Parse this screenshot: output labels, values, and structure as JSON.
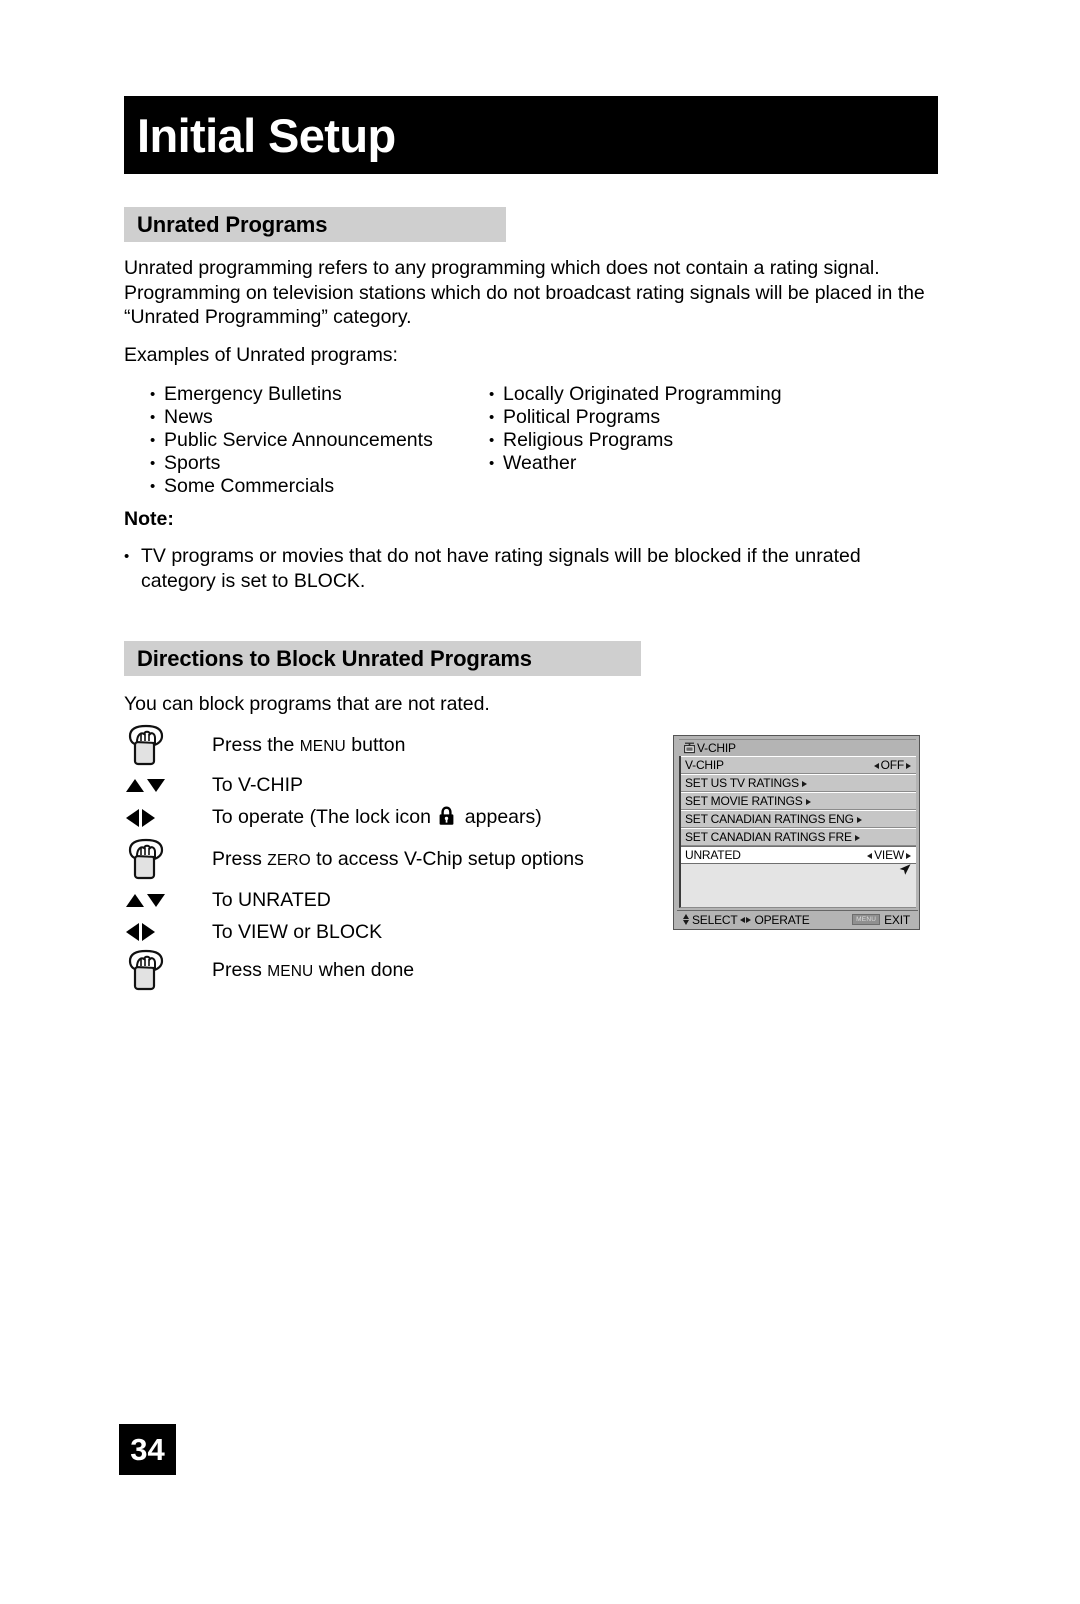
{
  "document": {
    "title": "Initial Setup",
    "page_number": "34"
  },
  "sections": {
    "unrated": {
      "heading": "Unrated Programs",
      "intro": "Unrated programming refers to any programming which does not contain a rating signal. Programming on television stations which do not broadcast rating signals will be placed in the “Unrated Programming” category.",
      "examples_label": "Examples of Unrated programs:",
      "examples_left": [
        "Emergency Bulletins",
        "News",
        "Public Service Announcements",
        "Sports",
        "Some Commercials"
      ],
      "examples_right": [
        "Locally Originated Programming",
        "Political Programs",
        "Religious Programs",
        "Weather"
      ],
      "note_heading": "Note:",
      "note_items": [
        "TV programs or movies that do not have rating signals will be blocked if the unrated category is set to BLOCK."
      ]
    },
    "directions": {
      "heading": "Directions to Block Unrated Programs",
      "intro": "You can block programs that are not rated.",
      "steps": [
        {
          "icon": "hand-press-button-icon",
          "text_before": "Press the ",
          "smallcaps": "MENU",
          "text_after": " button"
        },
        {
          "icon": "up-down-arrows-icon",
          "text_before": "To V-CHIP",
          "smallcaps": "",
          "text_after": ""
        },
        {
          "icon": "left-right-arrows-icon",
          "text_before": "To operate (The lock icon ",
          "smallcaps": "",
          "text_after": " appears)"
        },
        {
          "icon": "hand-press-button-icon",
          "text_before": "Press ",
          "smallcaps": "ZERO",
          "text_after": " to access V-Chip setup options"
        },
        {
          "icon": "up-down-arrows-icon",
          "text_before": "To UNRATED",
          "smallcaps": "",
          "text_after": ""
        },
        {
          "icon": "left-right-arrows-icon",
          "text_before": "To VIEW or BLOCK",
          "smallcaps": "",
          "text_after": ""
        },
        {
          "icon": "hand-press-button-icon",
          "text_before": "Press ",
          "smallcaps": "MENU",
          "text_after": " when done"
        }
      ]
    }
  },
  "osd": {
    "title": "V-CHIP",
    "title_icon": "tv-monitor-icon",
    "rows": [
      {
        "label": "V-CHIP",
        "value": "OFF",
        "value_arrows": true,
        "submenu_arrow": false,
        "highlight": false
      },
      {
        "label": "SET US TV RATINGS",
        "value": "",
        "value_arrows": false,
        "submenu_arrow": true,
        "highlight": false
      },
      {
        "label": "SET MOVIE RATINGS",
        "value": "",
        "value_arrows": false,
        "submenu_arrow": true,
        "highlight": false
      },
      {
        "label": "SET CANADIAN RATINGS ENG",
        "value": "",
        "value_arrows": false,
        "submenu_arrow": true,
        "highlight": false
      },
      {
        "label": "SET CANADIAN RATINGS FRE",
        "value": "",
        "value_arrows": false,
        "submenu_arrow": true,
        "highlight": false
      },
      {
        "label": "UNRATED",
        "value": "VIEW",
        "value_arrows": true,
        "submenu_arrow": false,
        "highlight": true
      }
    ],
    "footer": {
      "select_label": "SELECT",
      "operate_label": "OPERATE",
      "menu_chip": "MENU",
      "exit_label": "EXIT"
    }
  },
  "colors": {
    "banner_bg": "#000000",
    "banner_text": "#ffffff",
    "section_bar_bg": "#cfcfcf",
    "osd_bg": "#b4b4b4",
    "osd_row_bg": "#c6c6c6",
    "osd_highlight_bg": "#ffffff",
    "page_number_bg": "#000000"
  }
}
